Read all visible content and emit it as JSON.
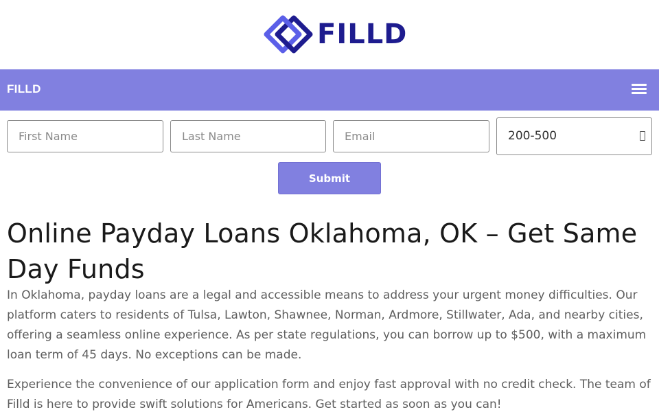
{
  "logo": {
    "text": "FILLD",
    "icon": "filld-logo-icon",
    "colors": {
      "primary": "#1e1c8f",
      "accent": "#5b5fe8"
    }
  },
  "nav": {
    "brand": "FILLD",
    "menu_icon": "hamburger-menu-icon",
    "background": "#8180e0"
  },
  "form": {
    "first_name_placeholder": "First Name",
    "last_name_placeholder": "Last Name",
    "email_placeholder": "Email",
    "amount_value": "200-500",
    "submit_label": "Submit",
    "button_color": "#8180e0"
  },
  "content": {
    "headline": "Online Payday Loans Oklahoma, OK – Get Same Day Funds",
    "paragraph1": "In Oklahoma, payday loans are a legal and accessible means to address your urgent money difficulties. Our platform caters to residents of Tulsa, Lawton, Shawnee, Norman, Ardmore, Stillwater, Ada, and nearby cities, offering a seamless online experience. As per state regulations, you can borrow up to $500, with a maximum loan term of 45 days. No exceptions can be made.",
    "paragraph2": "Experience the convenience of our application form and enjoy fast approval with no credit check. The team of Filld is here to provide swift solutions for Americans. Get started as soon as you can!"
  }
}
